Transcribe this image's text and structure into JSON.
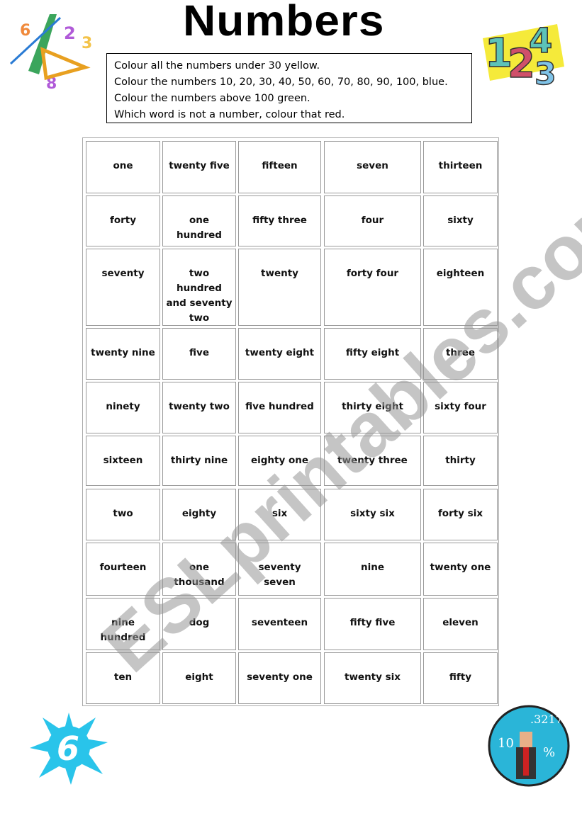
{
  "title": "Numbers",
  "instructions": [
    "Colour all the numbers under 30 yellow.",
    "Colour the numbers 10, 20, 30, 40, 50, 60, 70, 80, 90, 100, blue.",
    "Colour the numbers above 100 green.",
    "Which word is not a number, colour that red."
  ],
  "grid": [
    [
      "one",
      "twenty five",
      "fifteen",
      "seven",
      "thirteen"
    ],
    [
      "forty",
      "one hundred",
      "fifty three",
      "four",
      "sixty"
    ],
    [
      "seventy",
      "two hundred and seventy two",
      "twenty",
      "forty four",
      "eighteen"
    ],
    [
      "twenty nine",
      "five",
      "twenty eight",
      "fifty eight",
      "three"
    ],
    [
      "ninety",
      "twenty two",
      "five hundred",
      "thirty eight",
      "sixty four"
    ],
    [
      "sixteen",
      "thirty nine",
      "eighty one",
      "twenty three",
      "thirty"
    ],
    [
      "two",
      "eighty",
      "six",
      "sixty six",
      "forty six"
    ],
    [
      "fourteen",
      "one thousand",
      "seventy seven",
      "nine",
      "twenty one"
    ],
    [
      "nine hundred",
      "dog",
      "seventeen",
      "fifty five",
      "eleven"
    ],
    [
      "ten",
      "eight",
      "seventy one",
      "twenty six",
      "fifty"
    ]
  ],
  "watermark": "ESLprintables.com",
  "clipart": {
    "top_left": "math-symbols-clipart",
    "top_right": "3d-numbers-clipart",
    "bottom_left": "splash-six-clipart",
    "bottom_right": "math-teacher-clipart",
    "splash_digit": "6"
  },
  "colors": {
    "splash": "#29c4ea",
    "teacher_bg": "#2ab5d8"
  }
}
